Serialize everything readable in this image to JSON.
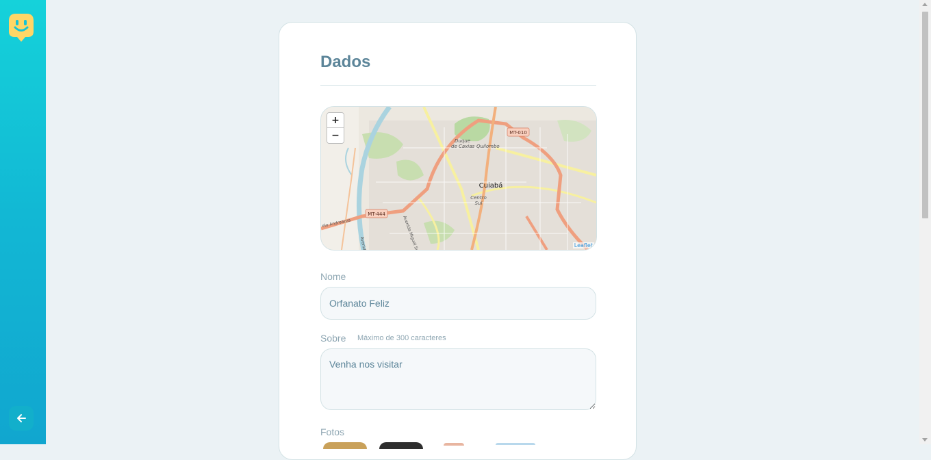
{
  "form": {
    "legend": "Dados",
    "map": {
      "zoom_in": "+",
      "zoom_out": "−",
      "attribution": "Leaflet",
      "city": "Cuiabá",
      "places": [
        "Duque",
        "de Caxias",
        "Quilombo",
        "Centro",
        "Sul"
      ],
      "roads": [
        "MT-010",
        "MT-444",
        "Avenida Miguel Sutil",
        "elo Andreazza",
        "Avenida Da"
      ]
    },
    "name": {
      "label": "Nome",
      "value": "Orfanato Feliz"
    },
    "about": {
      "label": "Sobre",
      "hint": "Máximo de 300 caracteres",
      "value": "Venha nos visitar"
    },
    "photos": {
      "label": "Fotos"
    }
  },
  "colors": {
    "sidebar_top": "#15d2da",
    "sidebar_bottom": "#11a6cf",
    "logo": "#ffd666",
    "title": "#5c8599",
    "label": "#8fa7b3"
  },
  "icons": {
    "logo": "smile-map-pin-icon",
    "back": "arrow-left-icon"
  }
}
